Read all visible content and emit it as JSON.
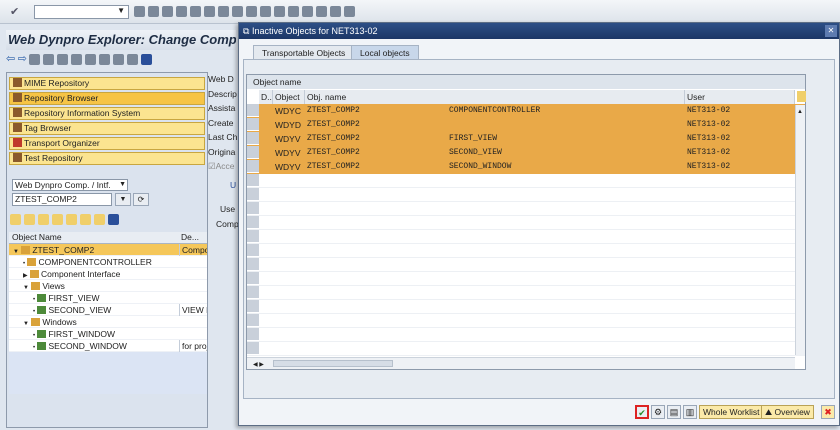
{
  "command_field": {
    "value": ""
  },
  "left": {
    "title": "Web Dynpro Explorer: Change Compo",
    "nav": [
      {
        "label": "MIME Repository"
      },
      {
        "label": "Repository Browser"
      },
      {
        "label": "Repository Information System"
      },
      {
        "label": "Tag Browser"
      },
      {
        "label": "Transport Organizer"
      },
      {
        "label": "Test Repository"
      }
    ],
    "object_type": "Web Dynpro Comp. / Intf.",
    "object_name": "ZTEST_COMP2",
    "tree_headers": [
      "Object Name",
      "De..."
    ],
    "tree": [
      {
        "label": "ZTEST_COMP2",
        "desc": "Compo",
        "level": 0,
        "exp": "▼"
      },
      {
        "label": "COMPONENTCONTROLLER",
        "desc": "",
        "level": 1,
        "exp": "•"
      },
      {
        "label": "Component Interface",
        "desc": "",
        "level": 1,
        "exp": "▶"
      },
      {
        "label": "Views",
        "desc": "",
        "level": 1,
        "exp": "▼"
      },
      {
        "label": "FIRST_VIEW",
        "desc": "",
        "level": 2,
        "exp": "•"
      },
      {
        "label": "SECOND_VIEW",
        "desc": "VIEW F",
        "level": 2,
        "exp": "•"
      },
      {
        "label": "Windows",
        "desc": "",
        "level": 1,
        "exp": "▼"
      },
      {
        "label": "FIRST_WINDOW",
        "desc": "",
        "level": 2,
        "exp": "•"
      },
      {
        "label": "SECOND_WINDOW",
        "desc": "for proj",
        "level": 2,
        "exp": "•"
      }
    ]
  },
  "middle": {
    "labels": [
      "Web D",
      "Descrip",
      "Assista",
      "Create",
      "Last Ch",
      "Origina",
      "Acce"
    ],
    "tab": "U",
    "col": "Use",
    "cell": "Comp"
  },
  "dialog": {
    "title": "Inactive Objects for NET313-02",
    "tabs": [
      "Transportable Objects",
      "Local objects"
    ],
    "group": "Object name",
    "columns": [
      "D..",
      "Object",
      "Obj. name",
      "",
      "User"
    ],
    "rows": [
      [
        "WDYC",
        "ZTEST_COMP2",
        "COMPONENTCONTROLLER",
        "NET313-02"
      ],
      [
        "WDYD",
        "ZTEST_COMP2",
        "",
        "NET313-02"
      ],
      [
        "WDYV",
        "ZTEST_COMP2",
        "FIRST_VIEW",
        "NET313-02"
      ],
      [
        "WDYV",
        "ZTEST_COMP2",
        "SECOND_VIEW",
        "NET313-02"
      ],
      [
        "WDYV",
        "ZTEST_COMP2",
        "SECOND_WINDOW",
        "NET313-02"
      ]
    ],
    "buttons": {
      "whole_worklist": "Whole Worklist",
      "overview": "Overview"
    },
    "highlight_color": "#e9a948"
  }
}
